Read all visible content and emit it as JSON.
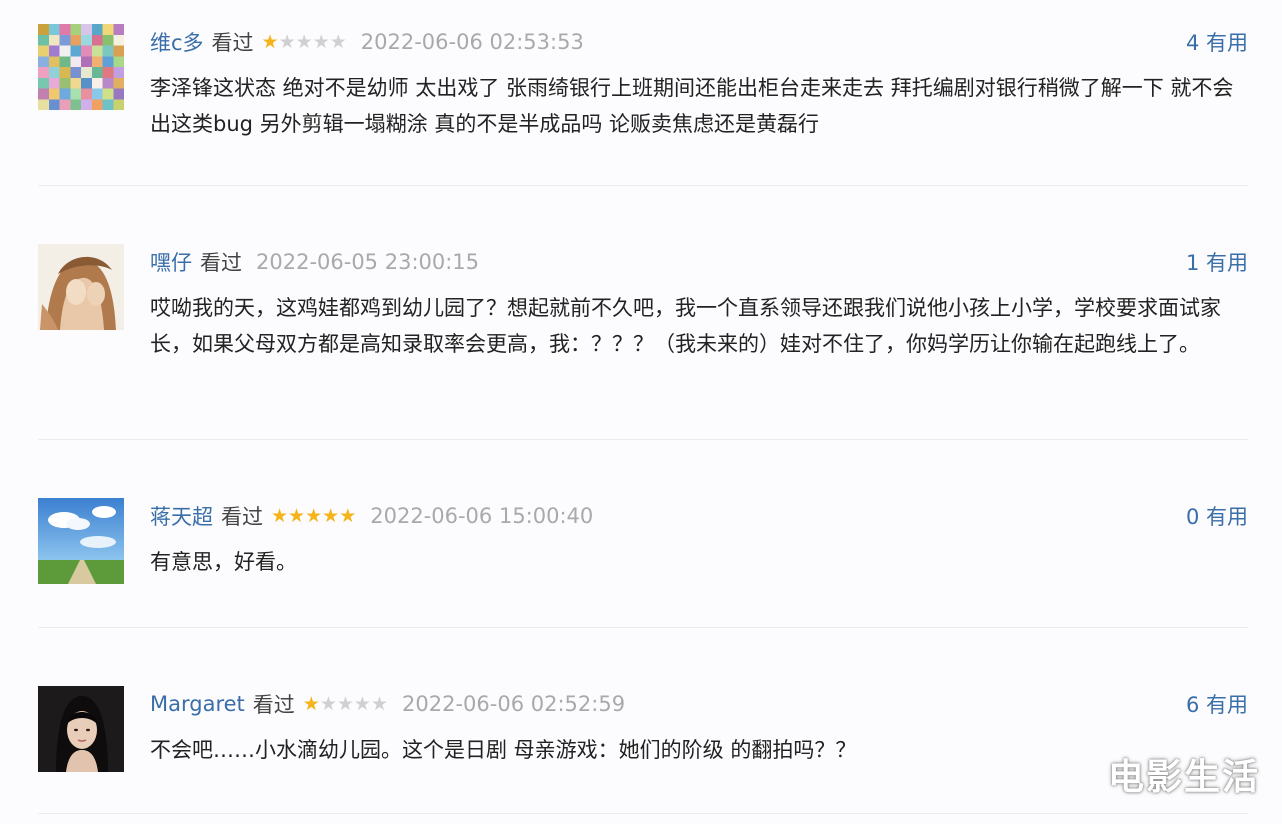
{
  "comments": [
    {
      "user": "维c多",
      "status": "看过",
      "rating": 1,
      "date": "2022-06-06 02:53:53",
      "votes": "4 有用",
      "content": "李泽锋这状态 绝对不是幼师 太出戏了 张雨绮银行上班期间还能出柜台走来走去 拜托编剧对银行稍微了解一下 就不会出这类bug 另外剪辑一塌糊涂 真的不是半成品吗 论贩卖焦虑还是黄磊行"
    },
    {
      "user": "嘿仔",
      "status": "看过",
      "rating": 0,
      "date": "2022-06-05 23:00:15",
      "votes": "1 有用",
      "content": "哎呦我的天，这鸡娃都鸡到幼儿园了？想起就前不久吧，我一个直系领导还跟我们说他小孩上小学，学校要求面试家长，如果父母双方都是高知录取率会更高，我：？？？（我未来的）娃对不住了，你妈学历让你输在起跑线上了。"
    },
    {
      "user": "蒋天超",
      "status": "看过",
      "rating": 5,
      "date": "2022-06-06 15:00:40",
      "votes": "0 有用",
      "content": "有意思，好看。"
    },
    {
      "user": "Margaret",
      "status": "看过",
      "rating": 1,
      "date": "2022-06-06 02:52:59",
      "votes": "6 有用",
      "content": "不会吧……小水滴幼儿园。这个是日剧 母亲游戏：她们的阶级 的翻拍吗？？"
    }
  ],
  "watermark": "电影生活",
  "colors": {
    "link": "#3a6ea8",
    "star": "#f4b41a",
    "date": "#a9a9a9"
  }
}
